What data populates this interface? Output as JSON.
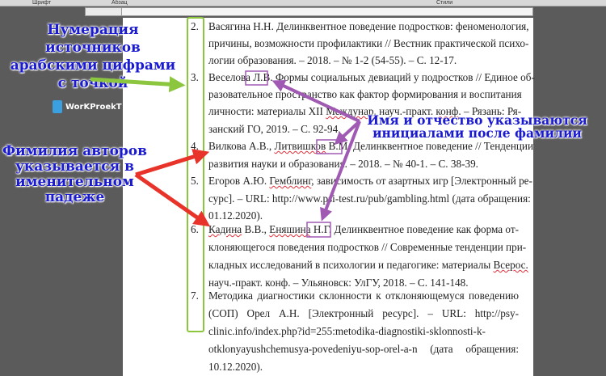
{
  "ribbon": {
    "font": "Шрифт",
    "paragraph": "Абзац",
    "styles": "Стили"
  },
  "items": [
    {
      "num": "2.",
      "lines": [
        "Васягина Н.Н. Делинквентное поведение подростков: феноменология,",
        "причины, возможности профилактики // Вестник практической психо-",
        "логии образования. – 2018. – № 1-2 (54-55). – С. 12-17."
      ]
    },
    {
      "num": "3.",
      "lines": [
        "Веселова Л.В. Формы социальных девиаций у подростков // Единое об-",
        "разовательное пространство как фактор формирования и воспитания",
        "личности: материалы XII Междунар. науч.-практ. конф. – Рязань: Ря-",
        "занский ГО, 2019. – С. 92-94."
      ]
    },
    {
      "num": "4.",
      "lines": [
        "Вилкова А.В., Литвишков В.М. Делинквентное поведение // Тенденции",
        "развития науки и образования. – 2018. – № 40-1. – С. 38-39."
      ]
    },
    {
      "num": "5.",
      "lines": [
        "Егоров А.Ю. Гемблинг, зависимость от азартных игр [Электронный ре-",
        "сурс]. – URL: http://www.psi-test.ru/pub/gambling.html (дата обращения:",
        "01.12.2020)."
      ]
    },
    {
      "num": "6.",
      "lines": [
        "Кадина В.В., Еняшина Н.Г. Делинквентное поведение как форма от-",
        "клоняющегося поведения подростков // Современные тенденции при-",
        "кладных исследований в психологии и педагогике: материалы Всерос.",
        "науч.-практ. конф. – Ульяновск: УлГУ, 2018. – С. 141-148."
      ]
    },
    {
      "num": "7.",
      "lines": [
        "Методика диагностики склонности к отклоняющемуся поведению",
        "(СОП) Орел А.Н. [Электронный ресурс]. – URL: http://psy-",
        "clinic.info/index.php?id=255:metodika-diagnostiki-sklonnosti-k-",
        "otklonyayushchemusya-povedeniyu-sop-orel-a-n (дата обращения:",
        "10.12.2020)."
      ]
    }
  ],
  "annotations": {
    "numbering": [
      "Нумерация источников",
      "арабскими цифрами",
      "с точкой"
    ],
    "surname": [
      "Фимилия авторов",
      "указывается в",
      "именительном",
      "падеже"
    ],
    "initials": [
      "Имя и отчество указываются",
      "инициалами после фамилии"
    ]
  },
  "logo": "WorKProekT",
  "colors": {
    "green": "#8cc63f",
    "red": "#e8332a",
    "purple": "#a05ab4",
    "blue": "#1a1ad0"
  }
}
